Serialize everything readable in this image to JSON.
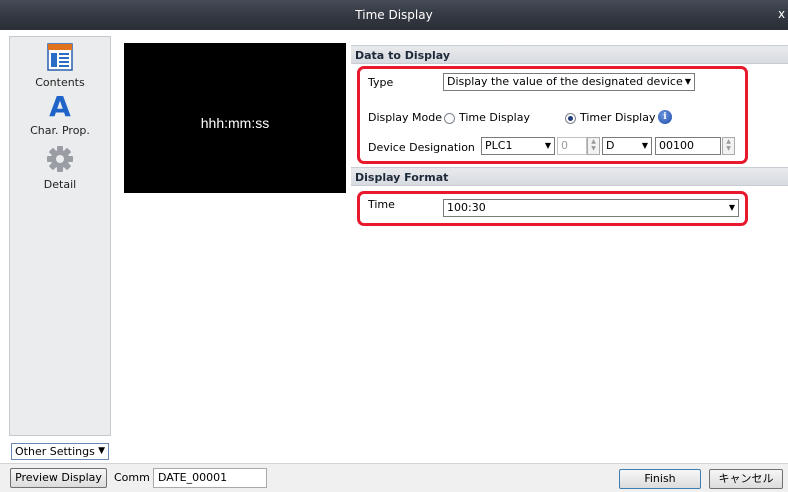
{
  "window": {
    "title": "Time Display",
    "close_glyph": "x"
  },
  "sidebar": {
    "items": [
      {
        "label": "Contents",
        "icon": "contents-icon"
      },
      {
        "label": "Char. Prop.",
        "icon": "char-prop-icon"
      },
      {
        "label": "Detail",
        "icon": "gear-icon"
      }
    ],
    "other_settings": "Other Settings"
  },
  "preview": {
    "format_text": "hhh:mm:ss"
  },
  "data_to_display": {
    "header": "Data to Display",
    "type_label": "Type",
    "type_value": "Display the value of the designated device",
    "display_mode_label": "Display Mode",
    "mode_options": [
      "Time Display",
      "Timer Display"
    ],
    "mode_selected": "Timer Display",
    "device_label": "Device Designation",
    "plc_value": "PLC1",
    "station_value": "0",
    "device_type": "D",
    "device_address": "00100"
  },
  "display_format": {
    "header": "Display Format",
    "time_label": "Time",
    "time_value": "100:30"
  },
  "footer": {
    "preview_button": "Preview Display",
    "comment_label": "Comm",
    "comment_value": "DATE_00001",
    "finish_button": "Finish",
    "cancel_button": "キャンセル"
  },
  "colors": {
    "highlight": "#e8192c",
    "titlebar": "#31363f",
    "accent": "#1c4aa8"
  }
}
